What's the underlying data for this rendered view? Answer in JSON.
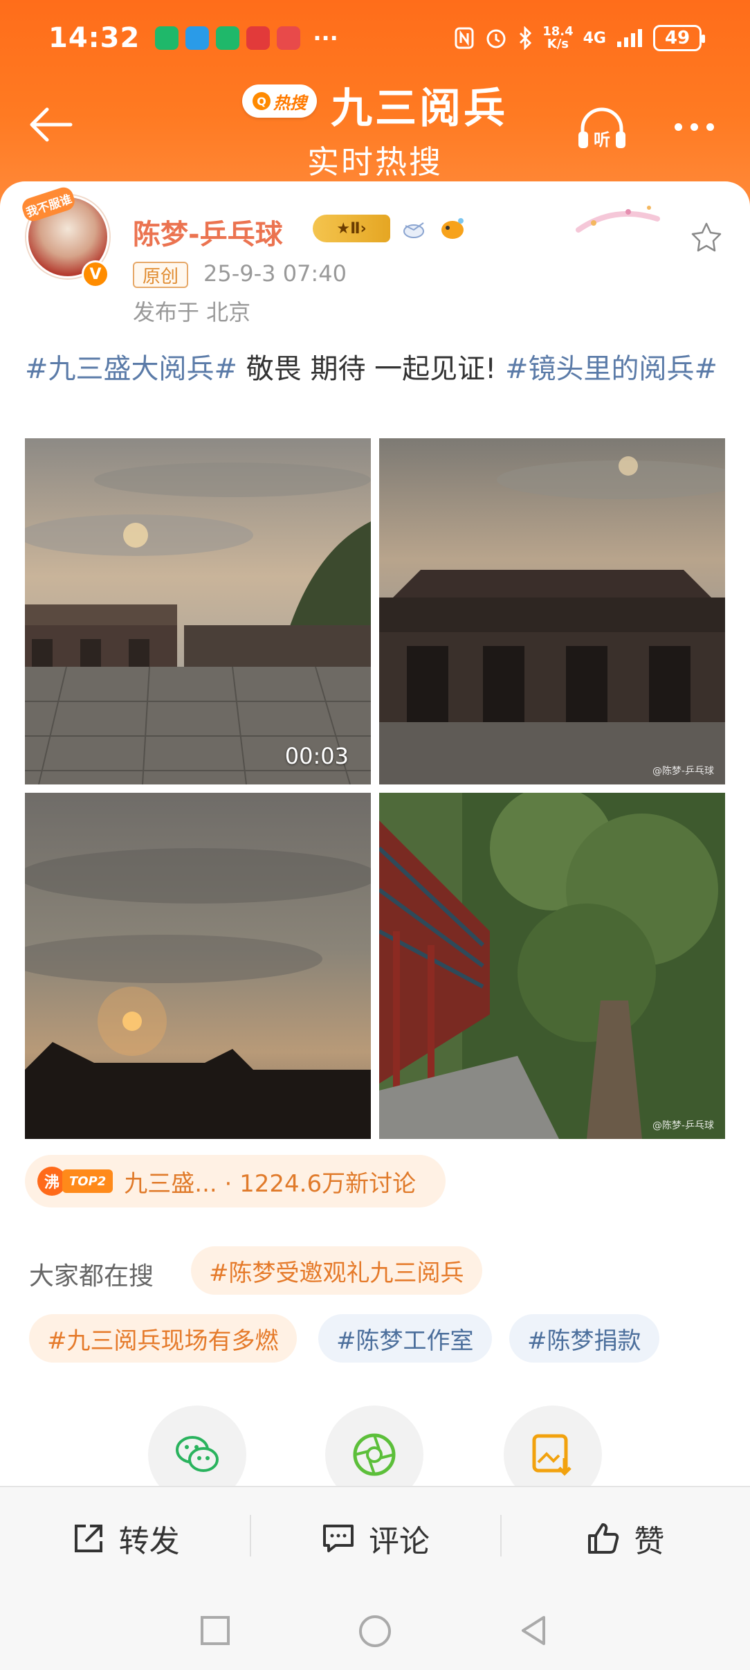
{
  "status_bar": {
    "time": "14:32",
    "net_speed_top": "18.4",
    "net_speed_bottom": "K/s",
    "network": "4G",
    "battery": "49",
    "more": "···"
  },
  "header": {
    "hot_badge": "热搜",
    "title": "九三阅兵",
    "subtitle": "实时热搜",
    "listen_label": "听"
  },
  "post": {
    "avatar_tag": "我不服谁",
    "username": "陈梦-乒乓球",
    "level": "Ⅱ",
    "origin_label": "原创",
    "time": "25-9-3 07:40",
    "location": "发布于 北京",
    "text_tag1": "#九三盛大阅兵#",
    "text_body": " 敬畏 期待  一起见证! ",
    "text_tag2": "#镜头里的阅兵#",
    "video_duration": "00:03",
    "watermark": "@陈梦-乒乓球"
  },
  "hot_topic": {
    "fei": "沸",
    "rank": "TOP2",
    "text": "九三盛... · 1224.6万新讨论"
  },
  "search": {
    "label": "大家都在搜",
    "chips": [
      "#陈梦受邀观礼九三阅兵",
      "#九三阅兵现场有多燃",
      "#陈梦工作室",
      "#陈梦捐款"
    ]
  },
  "actions": {
    "forward": "转发",
    "comment": "评论",
    "like": "赞"
  },
  "colors": {
    "header_orange": "#ff7a22",
    "username": "#eb7350",
    "hashtag": "#5b7ba8"
  }
}
